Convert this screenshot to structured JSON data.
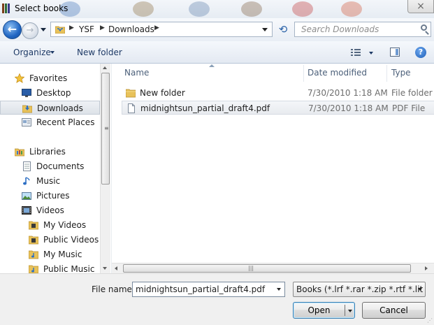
{
  "window": {
    "title": "Select books",
    "close_glyph": "×"
  },
  "navbar": {
    "breadcrumb": [
      "YSF",
      "Downloads"
    ],
    "search_placeholder": "Search Downloads"
  },
  "toolbar": {
    "organize": "Organize",
    "new_folder": "New folder"
  },
  "sidebar": {
    "favorites": {
      "label": "Favorites",
      "items": [
        "Desktop",
        "Downloads",
        "Recent Places"
      ],
      "selected": "Downloads"
    },
    "libraries": {
      "label": "Libraries",
      "items": [
        "Documents",
        "Music",
        "Pictures",
        "Videos"
      ],
      "subitems": [
        "My Videos",
        "Public Videos",
        "My Music",
        "Public Music"
      ]
    }
  },
  "filelist": {
    "columns": [
      "Name",
      "Date modified",
      "Type"
    ],
    "rows": [
      {
        "name": "New folder",
        "date": "7/30/2010 1:18 AM",
        "type": "File folder",
        "icon": "folder-icon"
      },
      {
        "name": "midnightsun_partial_draft4.pdf",
        "date": "7/30/2010 1:18 AM",
        "type": "PDF File",
        "icon": "file-icon"
      }
    ],
    "selected_row": 1
  },
  "footer": {
    "file_name_label": "File name:",
    "file_name_value": "midnightsun_partial_draft4.pdf",
    "filter": "Books (*.lrf *.rar *.zip *.rtf *.lit *.",
    "open": "Open",
    "cancel": "Cancel"
  },
  "colors": {
    "accent": "#2166c3",
    "folder": "#e8c25a",
    "selection": "#dde2e8"
  }
}
